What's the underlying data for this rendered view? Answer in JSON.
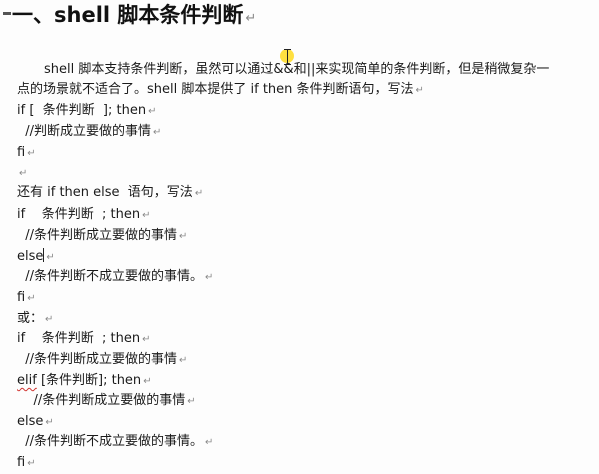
{
  "heading": {
    "text": "一、shell 脚本条件判断"
  },
  "intro": {
    "line1": "shell 脚本支持条件判断，虽然可以通过&&和||来实现简单的条件判断，但是稍微复杂一",
    "line2": "点的场景就不适合了。shell 脚本提供了 if then 条件判断语句，写法"
  },
  "code": {
    "l01": "if [  条件判断  ]; then",
    "l02": "  //判断成立要做的事情",
    "l03": "fi",
    "l04": "",
    "l05": "还有 if then else  语句，写法",
    "l06": "if    条件判断  ; then",
    "l07": "  //条件判断成立要做的事情",
    "l08": "else",
    "l09": "  //条件判断不成立要做的事情。",
    "l10": "fi",
    "l11": "或：",
    "l12": "if    条件判断  ; then",
    "l13": "  //条件判断成立要做的事情",
    "l14_kw": "elif",
    "l14_rest": " [条件判断]; then",
    "l15": "    //条件判断成立要做的事情",
    "l16": "else",
    "l17": "  //条件判断不成立要做的事情。",
    "l18": "fi"
  },
  "marks": {
    "paragraph": "↵"
  },
  "colors": {
    "spell_underline": "#d0312d",
    "cursor_highlight": "#ffd600"
  }
}
